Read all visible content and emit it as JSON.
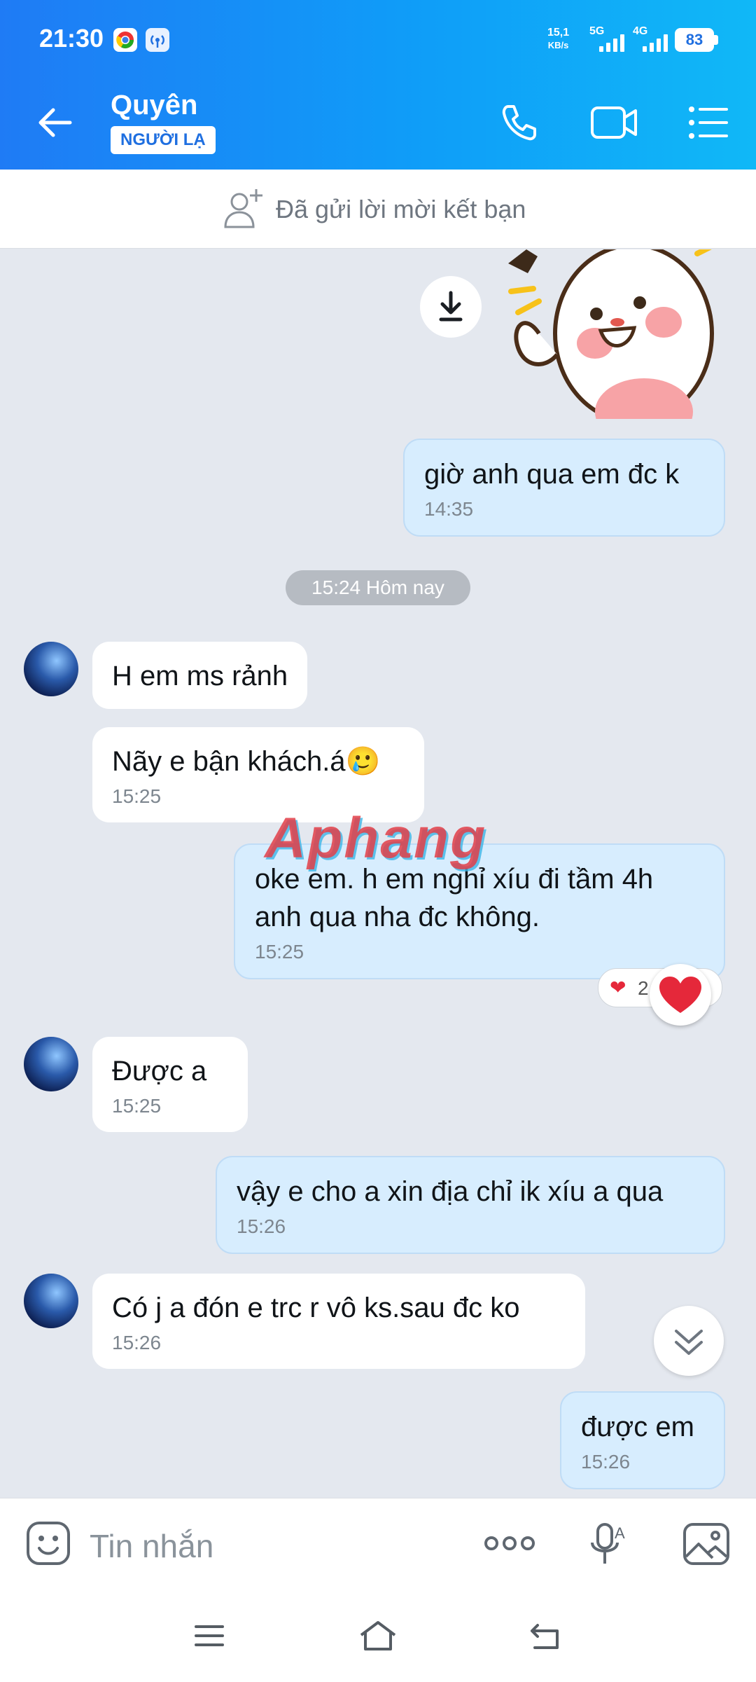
{
  "status_bar": {
    "time": "21:30",
    "net_speed_value": "15,1",
    "net_speed_unit": "KB/s",
    "net_5g": "5G",
    "net_4g": "4G",
    "battery": "83"
  },
  "header": {
    "name": "Quyên",
    "badge": "NGƯỜI LẠ"
  },
  "friend_request": {
    "text": "Đã gửi lời mời kết bạn"
  },
  "messages": {
    "m1": {
      "text": "giờ anh qua em đc k",
      "time": "14:35"
    },
    "date_divider": "15:24 Hôm nay",
    "m2": {
      "text": "H em ms rảnh"
    },
    "m3": {
      "text": "Nãy e bận khách.á🥲",
      "time": "15:25"
    },
    "m4": {
      "text_line1": "oke em. h em nghỉ xíu đi tầm 4h",
      "text_line2": "anh qua nha đc không.",
      "time": "15:25"
    },
    "m4_reaction_count": "2",
    "m5": {
      "text": "Được a",
      "time": "15:25"
    },
    "m6": {
      "text": "vậy e cho a xin địa chỉ ik xíu a qua",
      "time": "15:26"
    },
    "m7": {
      "text": "Có j a đón e trc r vô ks.sau đc ko",
      "time": "15:26"
    },
    "m8": {
      "text": "được em",
      "time": "15:26"
    }
  },
  "watermark": "Aphang",
  "composer": {
    "placeholder": "Tin nhắn"
  },
  "colors": {
    "header_start": "#1f7bf5",
    "header_end": "#10b8f7",
    "chat_bg": "#e4e8ef",
    "outgoing_bubble": "#d7edfe",
    "incoming_bubble": "#ffffff"
  }
}
